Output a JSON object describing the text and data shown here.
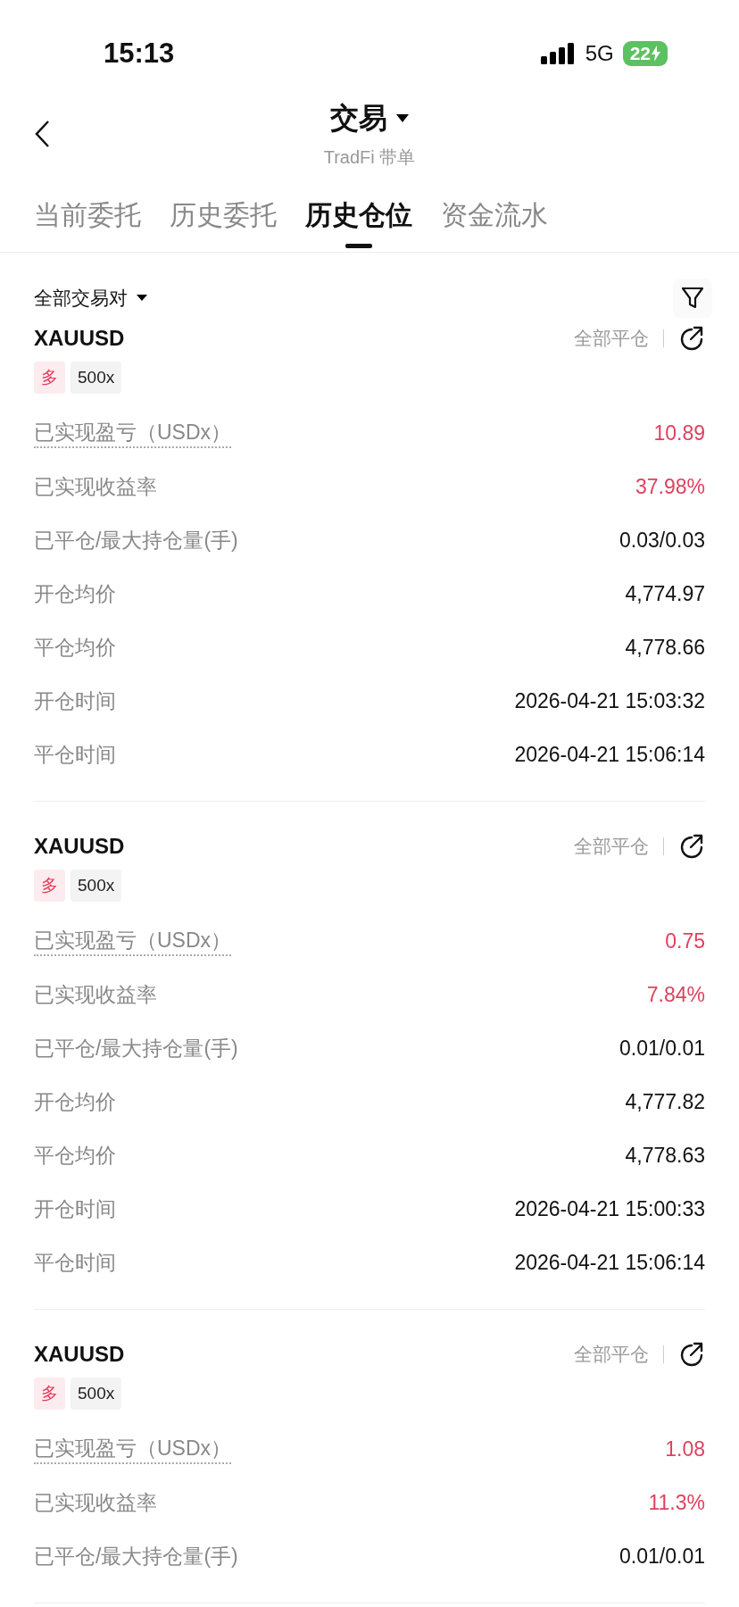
{
  "status_bar": {
    "time": "15:13",
    "network": "5G",
    "battery": "22"
  },
  "nav": {
    "title": "交易",
    "subtitle": "TradFi 带单"
  },
  "tabs": [
    {
      "label": "当前委托",
      "selected": false
    },
    {
      "label": "历史委托",
      "selected": false
    },
    {
      "label": "历史仓位",
      "selected": true
    },
    {
      "label": "资金流水",
      "selected": false
    }
  ],
  "filter": {
    "label": "全部交易对"
  },
  "positions": [
    {
      "symbol": "XAUUSD",
      "side": "多",
      "leverage": "500x",
      "action": "全部平仓",
      "rows": [
        {
          "label": "已实现盈亏（USDx）",
          "value": "10.89",
          "kind": "profit",
          "hint": true
        },
        {
          "label": "已实现收益率",
          "value": "37.98%",
          "kind": "profit",
          "hint": false
        },
        {
          "label": "已平仓/最大持仓量(手)",
          "value": "0.03/0.03",
          "kind": "plain",
          "hint": false
        },
        {
          "label": "开仓均价",
          "value": "4,774.97",
          "kind": "plain",
          "hint": false
        },
        {
          "label": "平仓均价",
          "value": "4,778.66",
          "kind": "plain",
          "hint": false
        },
        {
          "label": "开仓时间",
          "value": "2026-04-21 15:03:32",
          "kind": "plain",
          "hint": false
        },
        {
          "label": "平仓时间",
          "value": "2026-04-21 15:06:14",
          "kind": "plain",
          "hint": false
        }
      ]
    },
    {
      "symbol": "XAUUSD",
      "side": "多",
      "leverage": "500x",
      "action": "全部平仓",
      "rows": [
        {
          "label": "已实现盈亏（USDx）",
          "value": "0.75",
          "kind": "profit",
          "hint": true
        },
        {
          "label": "已实现收益率",
          "value": "7.84%",
          "kind": "profit",
          "hint": false
        },
        {
          "label": "已平仓/最大持仓量(手)",
          "value": "0.01/0.01",
          "kind": "plain",
          "hint": false
        },
        {
          "label": "开仓均价",
          "value": "4,777.82",
          "kind": "plain",
          "hint": false
        },
        {
          "label": "平仓均价",
          "value": "4,778.63",
          "kind": "plain",
          "hint": false
        },
        {
          "label": "开仓时间",
          "value": "2026-04-21 15:00:33",
          "kind": "plain",
          "hint": false
        },
        {
          "label": "平仓时间",
          "value": "2026-04-21 15:06:14",
          "kind": "plain",
          "hint": false
        }
      ]
    },
    {
      "symbol": "XAUUSD",
      "side": "多",
      "leverage": "500x",
      "action": "全部平仓",
      "rows": [
        {
          "label": "已实现盈亏（USDx）",
          "value": "1.08",
          "kind": "profit",
          "hint": true
        },
        {
          "label": "已实现收益率",
          "value": "11.3%",
          "kind": "profit",
          "hint": false
        },
        {
          "label": "已平仓/最大持仓量(手)",
          "value": "0.01/0.01",
          "kind": "plain",
          "hint": false
        }
      ]
    }
  ]
}
